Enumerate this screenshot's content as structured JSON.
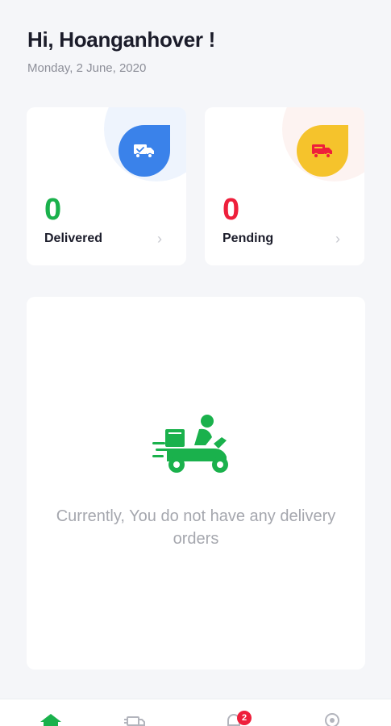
{
  "header": {
    "greeting": "Hi, Hoanganhover !",
    "date": "Monday,  2 June, 2020"
  },
  "stats": {
    "delivered": {
      "count": "0",
      "label": "Delivered",
      "icon": "delivery-truck-check-icon",
      "color": "#3a82ea",
      "count_color": "#1ab14c"
    },
    "pending": {
      "count": "0",
      "label": "Pending",
      "icon": "delivery-truck-icon",
      "color": "#f5c32c",
      "count_color": "#ee1f3b"
    }
  },
  "empty_state": {
    "illustration": "delivery-scooter-icon",
    "message": "Currently, You do not have any delivery orders",
    "accent_color": "#1ab14c"
  },
  "tabbar": {
    "tabs": [
      {
        "name": "home",
        "icon": "home-icon",
        "active": true
      },
      {
        "name": "orders",
        "icon": "truck-list-icon",
        "active": false
      },
      {
        "name": "notifications",
        "icon": "bell-icon",
        "active": false,
        "badge": "2"
      },
      {
        "name": "location",
        "icon": "location-pin-icon",
        "active": false
      }
    ]
  }
}
